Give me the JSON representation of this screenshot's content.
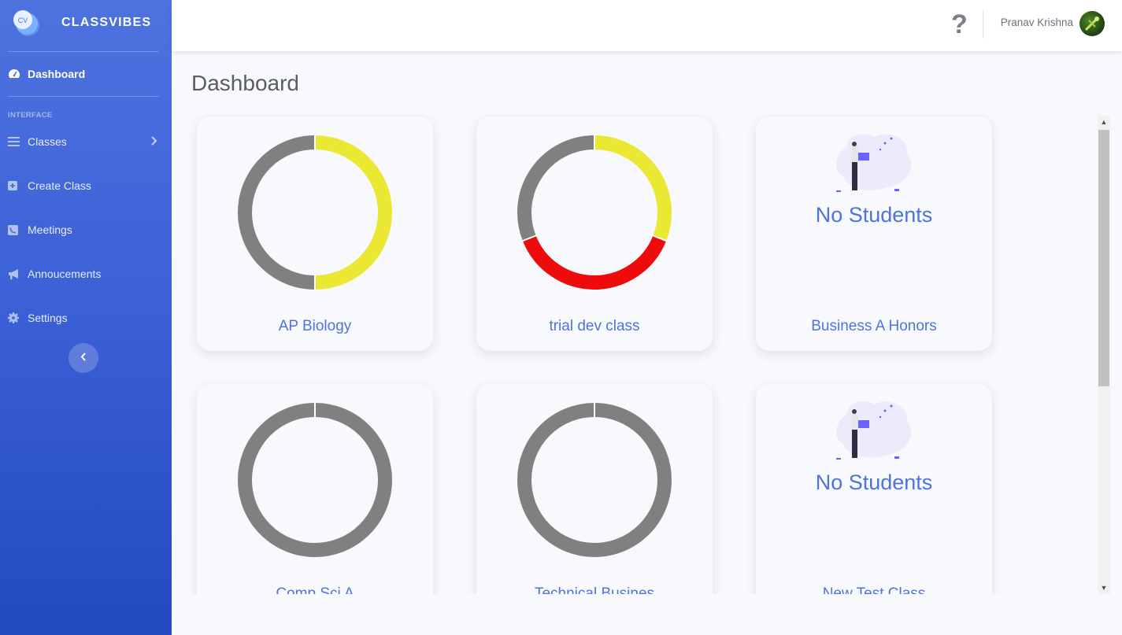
{
  "brand": {
    "name": "CLASSVIBES",
    "logo_text": "CV"
  },
  "sidebar": {
    "dashboard_label": "Dashboard",
    "heading": "INTERFACE",
    "items": [
      {
        "label": "Classes",
        "icon": "bars-icon"
      },
      {
        "label": "Create Class",
        "icon": "plus-square-icon"
      },
      {
        "label": "Meetings",
        "icon": "phone-icon"
      },
      {
        "label": "Annoucements",
        "icon": "bullhorn-icon"
      },
      {
        "label": "Settings",
        "icon": "gear-icon"
      }
    ]
  },
  "topbar": {
    "help": "?",
    "user_name": "Pranav Krishna"
  },
  "page": {
    "title": "Dashboard"
  },
  "colors": {
    "primary": "#4e73df",
    "gray": "#808080",
    "yellow": "#ebe834",
    "red": "#ed0b0b"
  },
  "classes": [
    {
      "name": "AP Biology",
      "chart": [
        {
          "color": "yellow",
          "value": 50
        },
        {
          "color": "gray",
          "value": 50
        }
      ]
    },
    {
      "name": "trial dev class",
      "chart": [
        {
          "color": "yellow",
          "value": 31
        },
        {
          "color": "red",
          "value": 38
        },
        {
          "color": "gray",
          "value": 31
        }
      ]
    },
    {
      "name": "Business A Honors",
      "no_students": "No Students"
    },
    {
      "name": "Comp Sci A",
      "chart": [
        {
          "color": "gray",
          "value": 100
        }
      ]
    },
    {
      "name": "Technical Busines",
      "chart": [
        {
          "color": "gray",
          "value": 100
        }
      ]
    },
    {
      "name": "New Test Class",
      "no_students": "No Students"
    }
  ]
}
